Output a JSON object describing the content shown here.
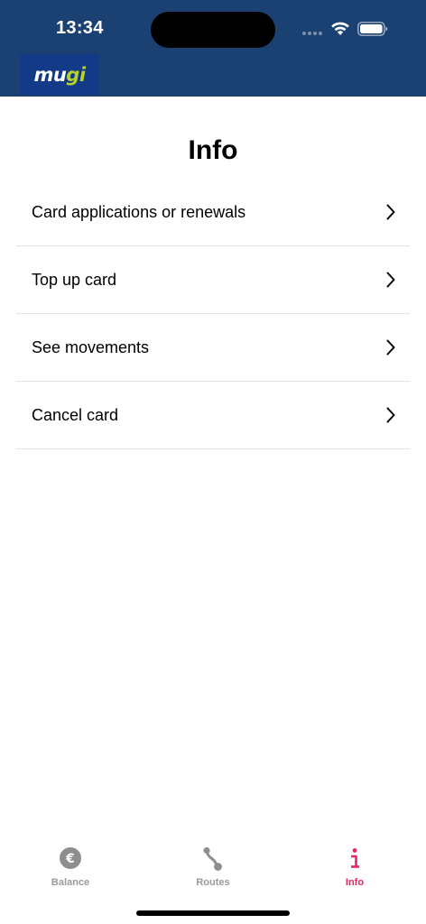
{
  "status_bar": {
    "time": "13:34"
  },
  "header": {
    "brand_logo": {
      "text_main": "mu",
      "text_accent": "gi",
      "background_color": "#123a86",
      "accent_color": "#b9d22b"
    },
    "background_color": "#1b4173"
  },
  "page": {
    "title": "Info"
  },
  "info_list": {
    "items": [
      {
        "label": "Card applications or renewals",
        "icon": "chevron-right-icon"
      },
      {
        "label": "Top up card",
        "icon": "chevron-right-icon"
      },
      {
        "label": "See movements",
        "icon": "chevron-right-icon"
      },
      {
        "label": "Cancel card",
        "icon": "chevron-right-icon"
      }
    ]
  },
  "tab_bar": {
    "tabs": [
      {
        "label": "Balance",
        "icon": "euro-coin-icon",
        "active": false
      },
      {
        "label": "Routes",
        "icon": "route-icon",
        "active": false
      },
      {
        "label": "Info",
        "icon": "info-icon",
        "active": true
      }
    ],
    "active_color": "#e8245c",
    "inactive_color": "#9a9a9a"
  }
}
